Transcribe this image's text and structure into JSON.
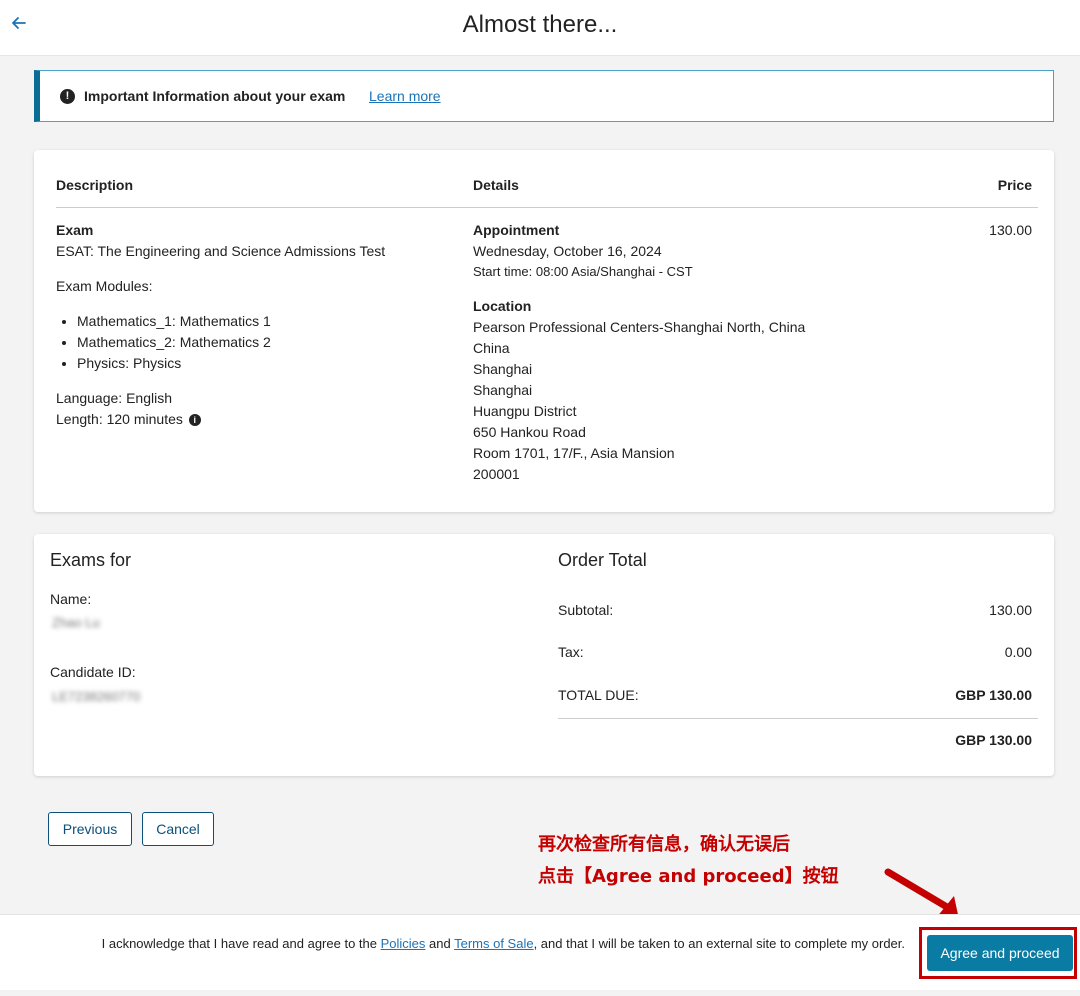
{
  "header": {
    "title": "Almost there...",
    "back_icon": "arrow-left-icon"
  },
  "banner": {
    "title": "Important Information about your exam",
    "link": "Learn more",
    "icon": "exclamation-circle-icon"
  },
  "description_table": {
    "headers": {
      "description": "Description",
      "details": "Details",
      "price": "Price"
    },
    "exam_label": "Exam",
    "exam_name": "ESAT: The Engineering and Science Admissions Test",
    "modules_label": "Exam Modules:",
    "modules": [
      "Mathematics_1: Mathematics 1",
      "Mathematics_2: Mathematics 2",
      "Physics: Physics"
    ],
    "language": "Language: English",
    "length": "Length: 120 minutes",
    "appointment_label": "Appointment",
    "appointment_date": "Wednesday, October 16, 2024",
    "start_time": "Start time: 08:00 Asia/Shanghai - CST",
    "location_label": "Location",
    "location_lines": [
      "Pearson Professional Centers-Shanghai North, China",
      "China",
      "Shanghai",
      "Shanghai",
      "Huangpu District",
      "650 Hankou Road",
      "Room 1701, 17/F., Asia Mansion",
      "200001"
    ],
    "price": "130.00"
  },
  "exams_for": {
    "title": "Exams for",
    "name_label": "Name:",
    "name_value": "Zhao Lu",
    "candidate_label": "Candidate ID:",
    "candidate_value": "LE7238260770"
  },
  "order_total": {
    "title": "Order Total",
    "subtotal_label": "Subtotal:",
    "subtotal_value": "130.00",
    "tax_label": "Tax:",
    "tax_value": "0.00",
    "total_due_label": "TOTAL DUE:",
    "total_due_value": "GBP 130.00",
    "grand_total": "GBP 130.00"
  },
  "buttons": {
    "previous": "Previous",
    "cancel": "Cancel",
    "agree": "Agree and proceed"
  },
  "annotation": {
    "line1": "再次检查所有信息，确认无误后",
    "line2": "点击【Agree and proceed】按钮",
    "color": "#c40000"
  },
  "footer": {
    "ack_part1": "I acknowledge that I have read and agree to the ",
    "policies": "Policies",
    "ack_and": " and ",
    "terms": "Terms of Sale",
    "ack_part2": ", and that I will be taken to an external site to complete my order."
  },
  "colors": {
    "accent": "#0a7ca3",
    "link": "#1a73b8",
    "banner_border": "#0b6d93"
  }
}
